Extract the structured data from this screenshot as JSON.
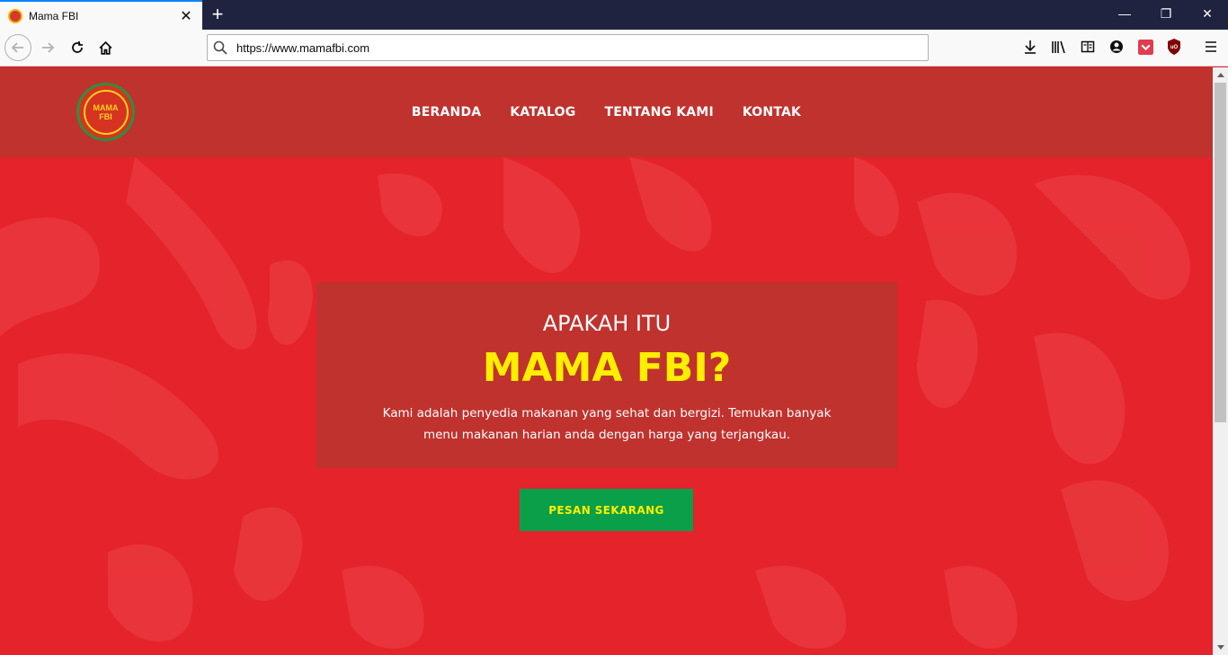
{
  "browser": {
    "tab_title": "Mama FBI",
    "url": "https://www.mamafbi.com",
    "tab_close": "✕",
    "new_tab": "+",
    "window_controls": {
      "minimize": "—",
      "restore": "❐",
      "close": "✕"
    }
  },
  "site": {
    "logo": {
      "top_text": "IDE TERBAIK WANITA",
      "name_line1": "MAMA",
      "name_line2": "FBI",
      "bottom_text": "AKTIF · CANTIK · CERDAS"
    },
    "nav": [
      "BERANDA",
      "KATALOG",
      "TENTANG KAMI",
      "KONTAK"
    ],
    "hero": {
      "pre_title": "APAKAH ITU",
      "title": "MAMA FBI?",
      "description": "Kami adalah penyedia makanan yang sehat dan bergizi. Temukan banyak menu makanan harian anda dengan harga yang terjangkau."
    },
    "cta_label": "PESAN SEKARANG"
  },
  "colors": {
    "page_bg": "#e4232a",
    "header_bg": "#c0322e",
    "hero_box_bg": "#c0322e",
    "title_yellow": "#ffee00",
    "cta_green": "#0a9f49",
    "tabbar_bg": "#202340"
  },
  "icons": [
    "back-icon",
    "forward-icon",
    "reload-icon",
    "home-icon",
    "search-icon",
    "download-icon",
    "library-icon",
    "reader-icon",
    "account-icon",
    "pocket-icon",
    "ublock-icon",
    "menu-icon"
  ]
}
